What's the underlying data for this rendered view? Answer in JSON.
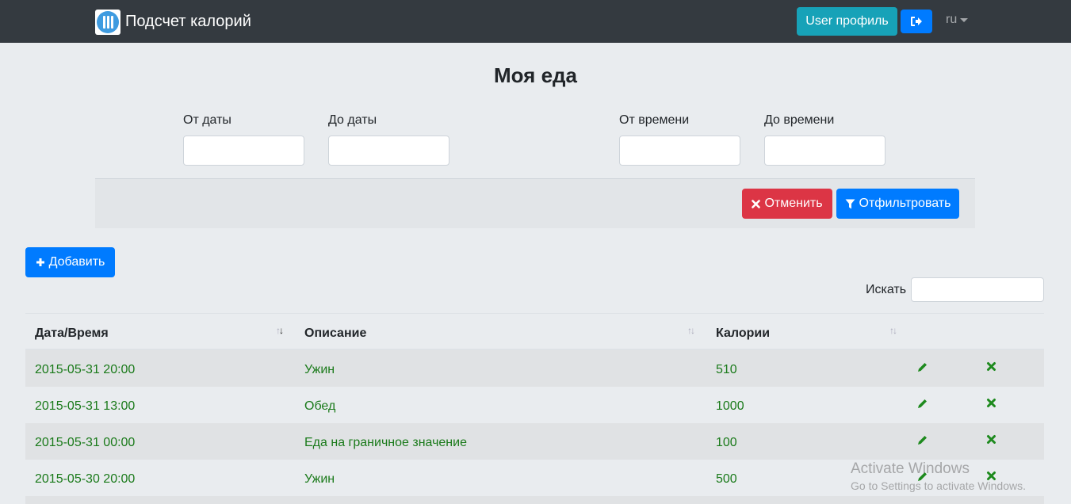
{
  "navbar": {
    "brand": "Подсчет калорий",
    "profile_button": "User профиль",
    "language": "ru"
  },
  "page": {
    "title": "Моя еда"
  },
  "filter": {
    "from_date_label": "От даты",
    "to_date_label": "До даты",
    "from_time_label": "От времени",
    "to_time_label": "До времени",
    "from_date": "",
    "to_date": "",
    "from_time": "",
    "to_time": "",
    "cancel_button": "Отменить",
    "filter_button": "Отфильтровать"
  },
  "add_button": "Добавить",
  "search": {
    "label": "Искать",
    "value": ""
  },
  "table": {
    "columns": [
      "Дата/Время",
      "Описание",
      "Калории"
    ],
    "rows": [
      {
        "datetime": "2015-05-31 20:00",
        "description": "Ужин",
        "calories": "510"
      },
      {
        "datetime": "2015-05-31 13:00",
        "description": "Обед",
        "calories": "1000"
      },
      {
        "datetime": "2015-05-31 00:00",
        "description": "Еда на граничное значение",
        "calories": "100"
      },
      {
        "datetime": "2015-05-30 20:00",
        "description": "Ужин",
        "calories": "500"
      }
    ]
  },
  "watermark": {
    "line1": "Activate Windows",
    "line2": "Go to Settings to activate Windows."
  },
  "colors": {
    "navbar": "#343a40",
    "row_text": "#1a7a1a",
    "primary": "#007bff",
    "danger": "#dc3545",
    "info": "#17a2b8"
  }
}
